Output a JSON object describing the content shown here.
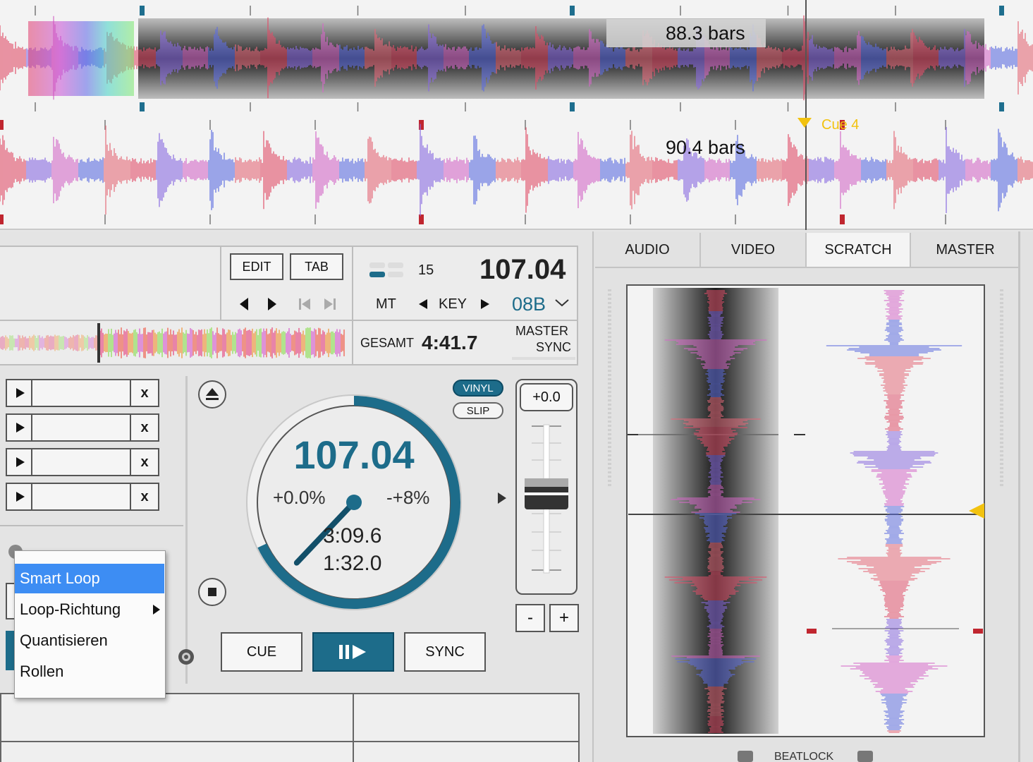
{
  "waveform": {
    "top_bars_label": "88.3 bars",
    "bottom_bars_label": "90.4 bars",
    "cue_label": "Cue 4"
  },
  "deck": {
    "edit_label": "EDIT",
    "tab_label": "TAB",
    "mt_label": "MT",
    "key_label": "KEY",
    "key_value": "08B",
    "pitch_range_number": "15",
    "bpm_top": "107.04",
    "gesamt_label": "GESAMT",
    "gesamt_value": "4:41.7",
    "master_label": "MASTER",
    "sync_small_label": "SYNC",
    "vinyl_label": "VINYL",
    "slip_label": "SLIP",
    "pitch_value": "+0.0",
    "minus_label": "-",
    "plus_label": "+",
    "platter_bpm": "107.04",
    "platter_pitch_left": "+0.0%",
    "platter_pitch_right": "-+8%",
    "platter_elapsed": "3:09.6",
    "platter_remaining": "1:32.0",
    "platter_progress_fraction": 0.68,
    "cue_button": "CUE",
    "sync_button": "SYNC",
    "slot_close": "x"
  },
  "context_menu": {
    "items": [
      {
        "label": "Smart Loop",
        "selected": true
      },
      {
        "label": "Loop-Richtung",
        "submenu": true
      },
      {
        "label": "Quantisieren"
      },
      {
        "label": "Rollen"
      }
    ]
  },
  "right_panel": {
    "tabs": [
      "AUDIO",
      "VIDEO",
      "SCRATCH",
      "MASTER"
    ],
    "active_tab": "SCRATCH",
    "beatlock_label": "BEATLOCK"
  },
  "colors": {
    "accent_teal": "#1d6c8a",
    "selection_blue": "#3d8df3",
    "cue_yellow": "#f2c20f",
    "marker_red": "#c0262f",
    "marker_blue": "#1e6e8e"
  }
}
